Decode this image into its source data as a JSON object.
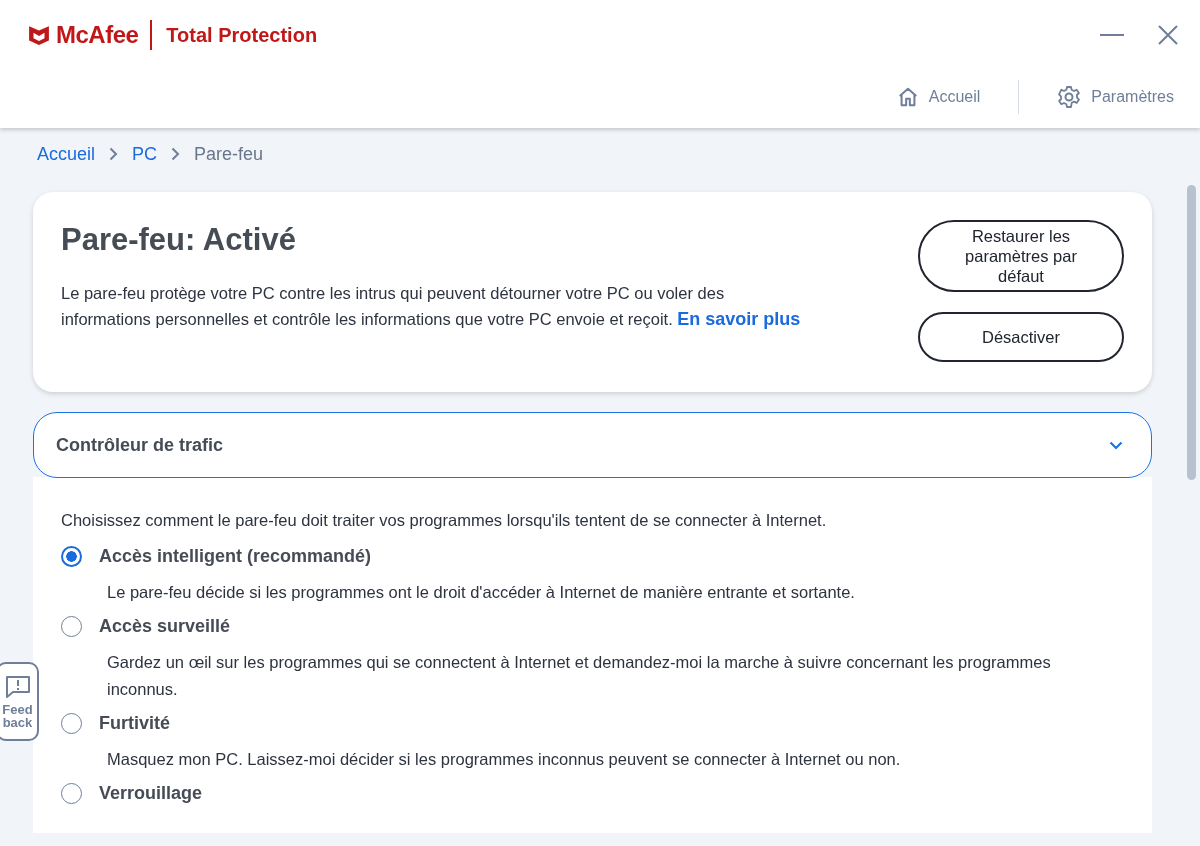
{
  "brand": {
    "name": "McAfee",
    "product": "Total Protection"
  },
  "nav": [
    {
      "kind": "home",
      "label": "Accueil"
    },
    {
      "kind": "settings",
      "label": "Paramètres"
    }
  ],
  "breadcrumb": [
    {
      "label": "Accueil",
      "link": true
    },
    {
      "label": "PC",
      "link": true
    },
    {
      "label": "Pare-feu",
      "link": false
    }
  ],
  "status_card": {
    "title": "Pare-feu: Activé",
    "description": "Le pare-feu protège votre PC contre les intrus qui peuvent détourner votre PC ou voler des informations personnelles et contrôle les informations que votre PC envoie et reçoit.",
    "link": "En savoir plus",
    "buttons": [
      "Restaurer les paramètres par défaut",
      "Désactiver"
    ]
  },
  "section": {
    "title": "Contrôleur de trafic",
    "expanded": true,
    "intro": "Choisissez comment le pare-feu doit traiter vos programmes lorsqu'ils tentent de se connecter à Internet.",
    "options": [
      {
        "label": "Accès intelligent (recommandé)",
        "description": "Le pare-feu décide si les programmes ont le droit d'accéder à Internet de manière entrante et sortante.",
        "selected": true
      },
      {
        "label": "Accès surveillé",
        "description": "Gardez un œil sur les programmes qui se connectent à Internet et demandez-moi la marche à suivre concernant les programmes inconnus.",
        "selected": false
      },
      {
        "label": "Furtivité",
        "description": "Masquez mon PC. Laissez-moi décider si les programmes inconnus peuvent se connecter à Internet ou non.",
        "selected": false
      },
      {
        "label": "Verrouillage",
        "selected": false
      }
    ]
  },
  "feedback": {
    "label": "Feed back"
  }
}
